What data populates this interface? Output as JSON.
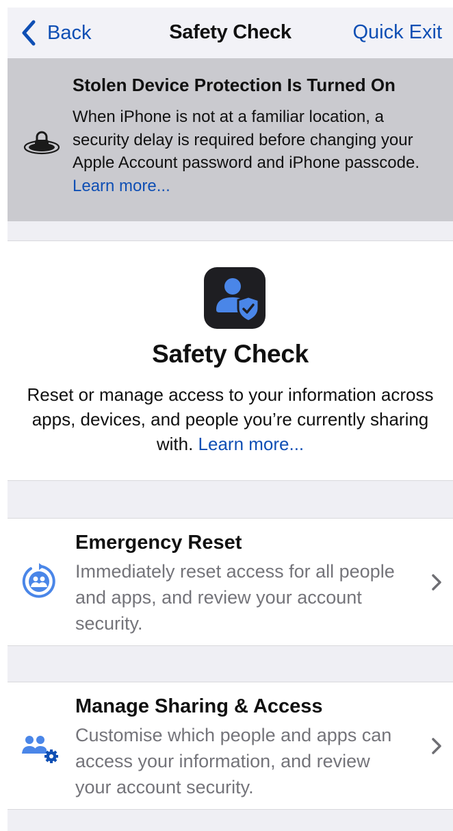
{
  "nav": {
    "back_label": "Back",
    "title": "Safety Check",
    "quick_exit_label": "Quick Exit"
  },
  "banner": {
    "icon": "lock-on-circle-icon",
    "title": "Stolen Device Protection Is Turned On",
    "body": "When iPhone is not at a familiar location, a security delay is required before changing your Apple Account password and iPhone passcode.",
    "learn_more": "Learn more..."
  },
  "hero": {
    "icon": "person-with-shield-check-icon",
    "title": "Safety Check",
    "body": "Reset or manage access to your information across apps, devices, and people you’re currently sharing with.",
    "learn_more": "Learn more..."
  },
  "options": [
    {
      "icon": "emergency-reset-people-icon",
      "title": "Emergency Reset",
      "description": "Immediately reset access for all people and apps, and review your account security."
    },
    {
      "icon": "people-gear-icon",
      "title": "Manage Sharing & Access",
      "description": "Customise which people and apps can access your information, and review your account security."
    }
  ],
  "colors": {
    "accent": "#0f4fb4",
    "icon_blue": "#4a86e8",
    "banner_bg": "#cacacf",
    "group_bg": "#efeff4",
    "secondary_text": "#74747a"
  }
}
